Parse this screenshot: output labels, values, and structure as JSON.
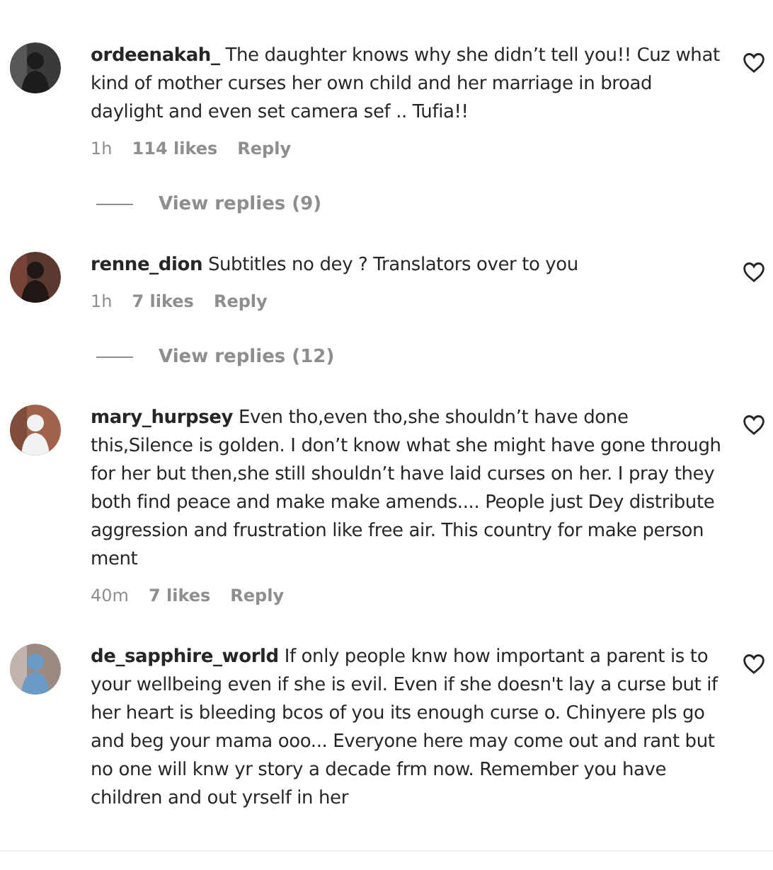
{
  "comments": [
    {
      "text": "**ordeenakah_** The daughter knows why she didn’t tell you!! Cuz what kind of mother curses her own child and her marriage in broad daylight and even set camera sef .. Tufia!!",
      "time": "1h",
      "likes": "114 likes",
      "reply": "Reply",
      "liked": false,
      "view_replies": "View replies (9)"
    },
    {
      "text": "**renne_dion** Subtitles no dey ? Translators over to you",
      "time": "1h",
      "likes": "7 likes",
      "reply": "Reply",
      "liked": false,
      "view_replies": "View replies (12)"
    },
    {
      "text": "**mary_hurpsey** Even tho,even tho,she shouldn’t have done this,Silence is golden. I don’t know what she might have gone through for her but then,she still shouldn’t have laid curses on her. I pray they both find peace and make make amends.... People just Dey distribute aggression and frustration like free air. This country for make person ment",
      "time": "40m",
      "likes": "7 likes",
      "reply": "Reply",
      "liked": false
    },
    {
      "text": "**de_sapphire_world** If only people knw how important a parent is to your wellbeing even if she is evil. Even if she doesn't lay a curse but if her heart is bleeding bcos of you its enough curse o. Chinyere pls go and beg your mama ooo... Everyone here may come out and rant but no one will knw yr story a decade frm now. Remember you have children and out yrself in her",
      "liked": false
    }
  ]
}
